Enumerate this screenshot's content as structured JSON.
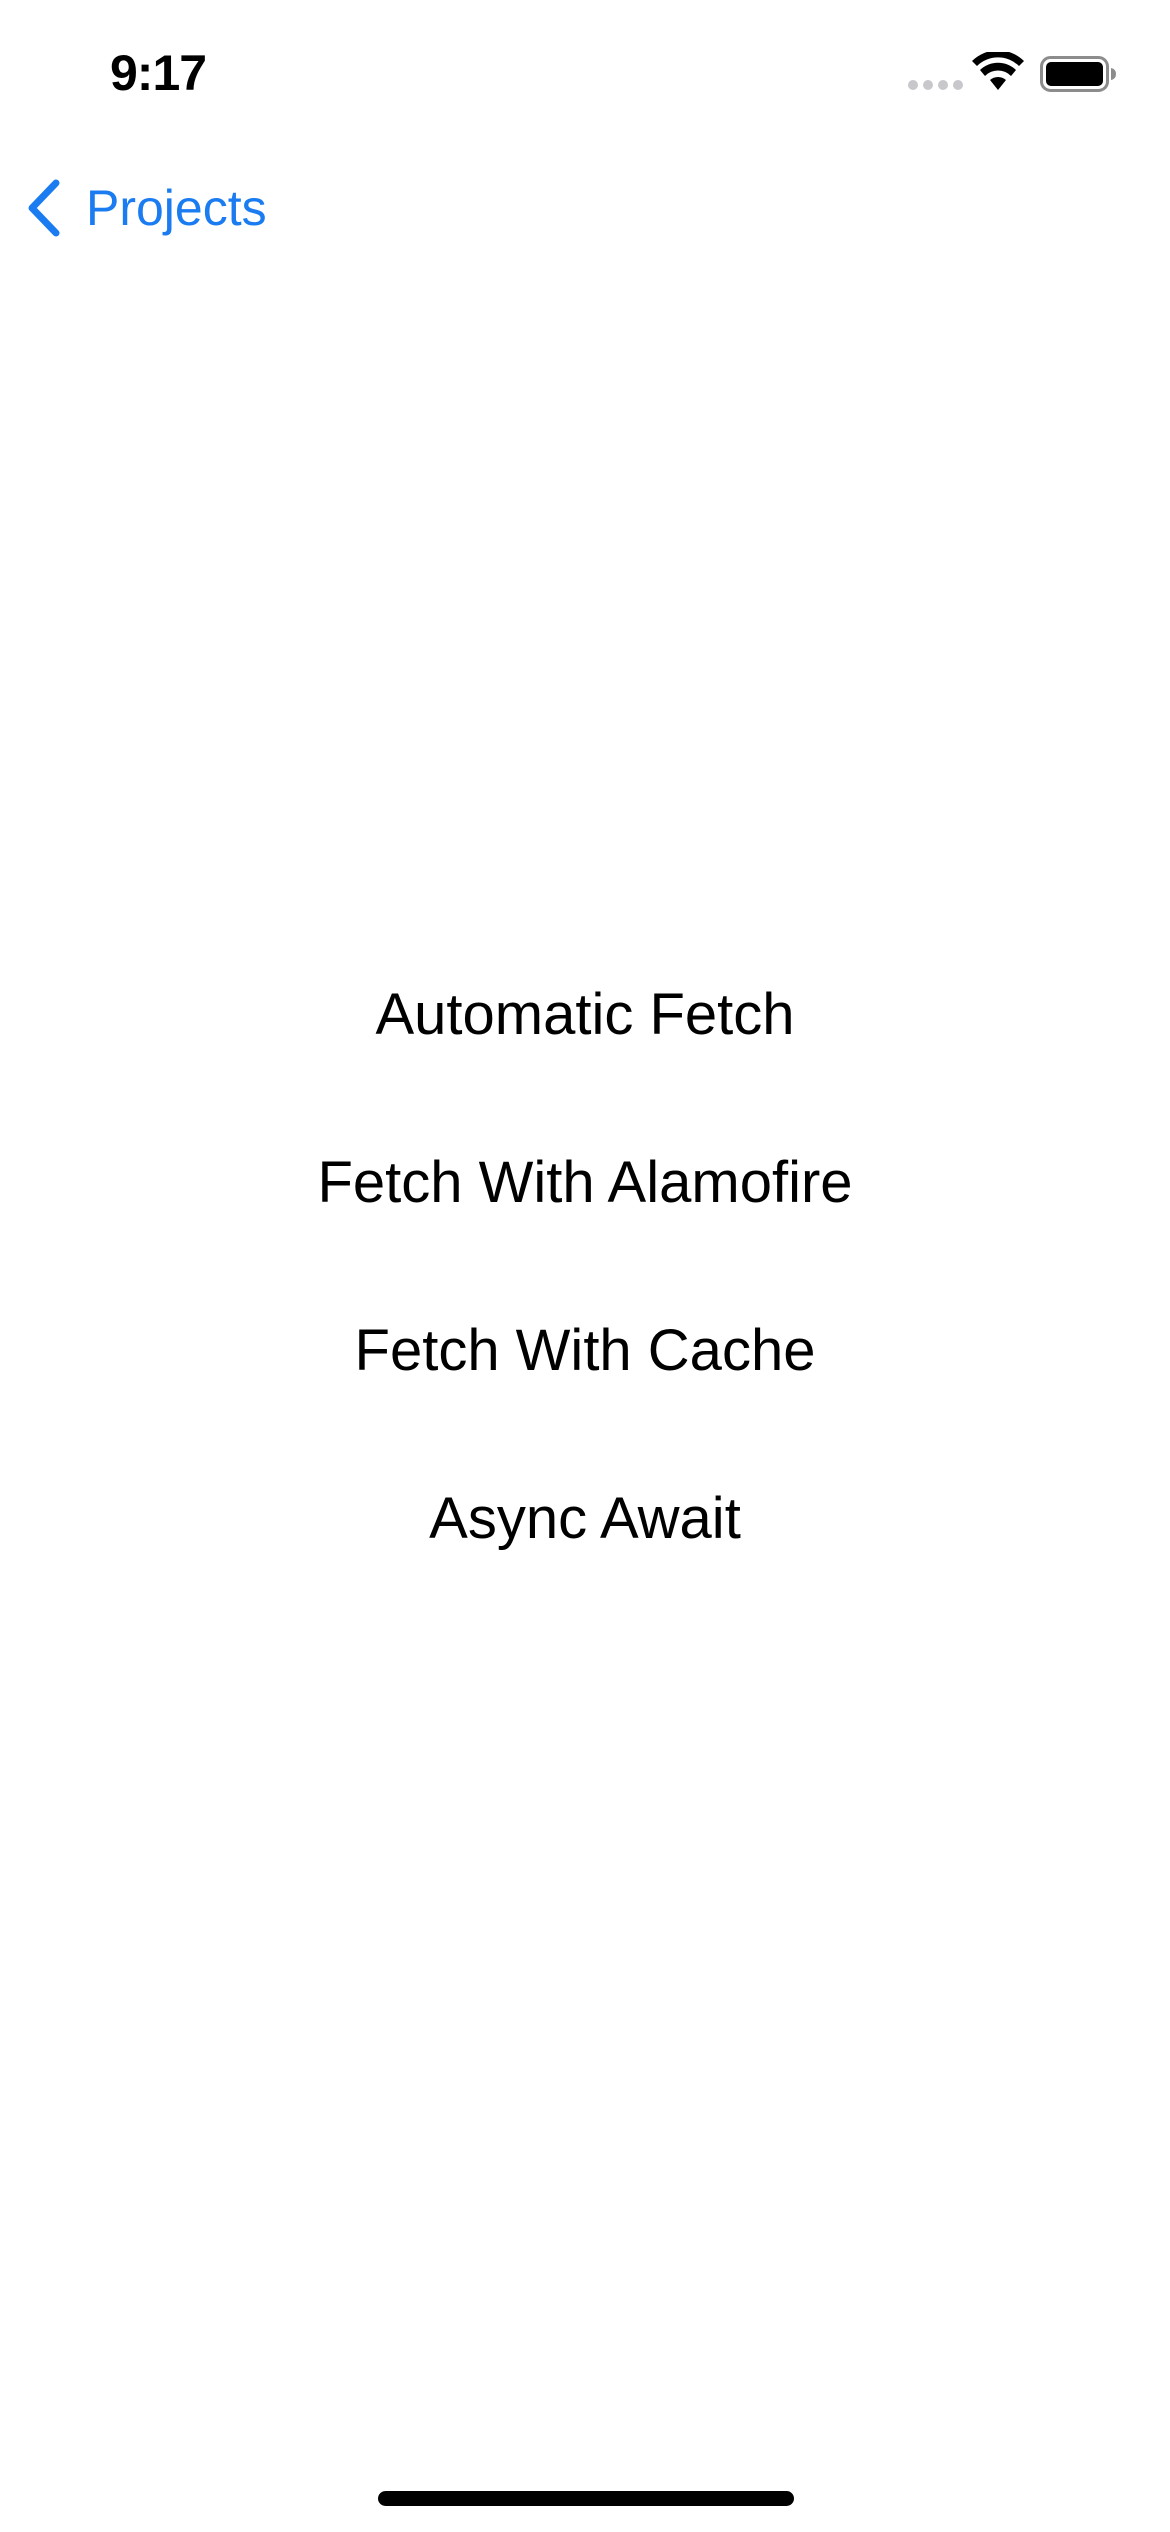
{
  "status_bar": {
    "time": "9:17",
    "icons": [
      "cellular-signal-icon",
      "wifi-icon",
      "battery-icon"
    ]
  },
  "nav": {
    "back_label": "Projects",
    "back_icon": "chevron-left-icon",
    "accent_color": "#1a7cf0"
  },
  "menu": {
    "items": [
      {
        "label": "Automatic Fetch"
      },
      {
        "label": "Fetch With Alamofire"
      },
      {
        "label": "Fetch With Cache"
      },
      {
        "label": "Async Await"
      }
    ]
  }
}
